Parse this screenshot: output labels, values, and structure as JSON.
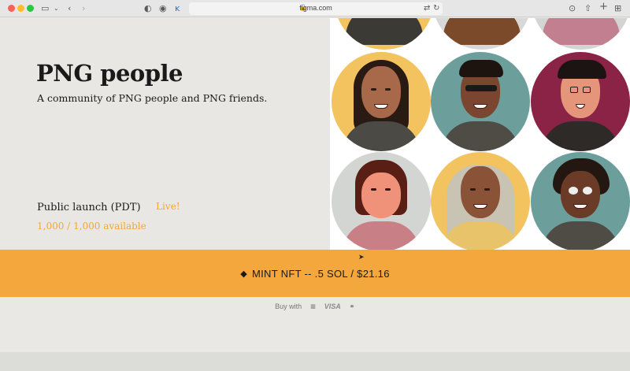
{
  "browser": {
    "url": "figma.com",
    "colors": {
      "close": "#fe5f57",
      "minimize": "#febc2e",
      "zoom": "#28c840"
    }
  },
  "hero": {
    "title": "PNG people",
    "subtitle": "A community of PNG people and PNG friends.",
    "launch_label": "Public launch (PDT)",
    "live_label": "Live!",
    "availability": "1,000 / 1,000 available"
  },
  "mint": {
    "label": "MINT NFT -- .5 SOL / $21.16",
    "icon": "diamond-icon",
    "color": "#f3a73d"
  },
  "payment": {
    "buy_with": "Buy with",
    "visa": "VISA"
  },
  "accent_color": "#f1a73a"
}
